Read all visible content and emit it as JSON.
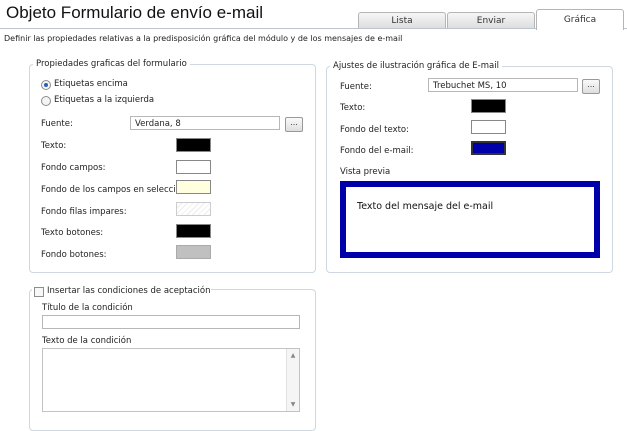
{
  "header": {
    "title": "Objeto Formulario de envío e-mail",
    "description": "Definir las propiedades relativas a la predisposición gráfica del módulo y de los mensajes de e-mail"
  },
  "tabs": [
    {
      "label": "Lista",
      "active": false
    },
    {
      "label": "Enviar",
      "active": false
    },
    {
      "label": "Gráfica",
      "active": true
    }
  ],
  "form_props": {
    "legend": "Propiedades graficas del formulario",
    "radio_above": "Etiquetas encima",
    "radio_left": "Etiquetas a la izquierda",
    "selected_radio": "above",
    "font_label": "Fuente:",
    "font_value": "Verdana, 8",
    "browse_label": "...",
    "colors": [
      {
        "label": "Texto:",
        "color": "#000000"
      },
      {
        "label": "Fondo campos:",
        "color": "#ffffff"
      },
      {
        "label": "Fondo de los campos en selección:",
        "color": "#ffffe0"
      },
      {
        "label": "Fondo filas impares:",
        "color": "#f4f4f4"
      },
      {
        "label": "Texto botones:",
        "color": "#000000"
      },
      {
        "label": "Fondo botones:",
        "color": "#c0c0c0"
      }
    ]
  },
  "email_props": {
    "legend": "Ajustes de ilustración gráfica de E-mail",
    "font_label": "Fuente:",
    "font_value": "Trebuchet MS, 10",
    "browse_label": "...",
    "colors": [
      {
        "label": "Texto:",
        "color": "#000000"
      },
      {
        "label": "Fondo del texto:",
        "color": "#ffffff"
      },
      {
        "label": "Fondo del e-mail:",
        "color": "#0000aa"
      }
    ],
    "preview_label": "Vista previa",
    "preview_text": "Texto del mensaje del e-mail"
  },
  "conditions": {
    "checkbox_label": "Insertar las condiciones de aceptación",
    "checked": false,
    "title_label": "Título de la condición",
    "title_value": "",
    "text_label": "Texto de la condición",
    "text_value": ""
  }
}
